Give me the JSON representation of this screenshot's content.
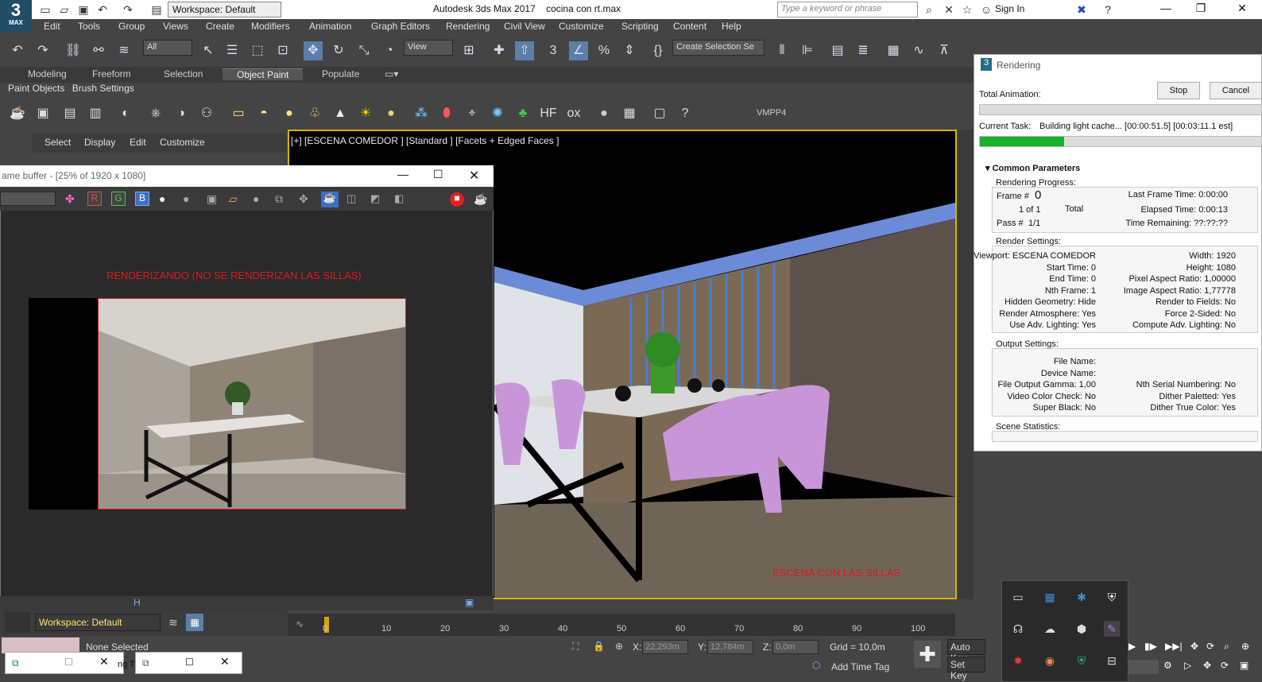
{
  "app": {
    "title": "Autodesk 3ds Max 2017",
    "file": "cocina con rt.max",
    "logo_num": "3",
    "logo_txt": "MAX"
  },
  "workspace": "Workspace: Default",
  "search_placeholder": "Type a keyword or phrase",
  "signin": "Sign In",
  "menu": [
    "Edit",
    "Tools",
    "Group",
    "Views",
    "Create",
    "Modifiers",
    "Animation",
    "Graph Editors",
    "Rendering",
    "Civil View",
    "Customize",
    "Scripting",
    "Content",
    "Help"
  ],
  "toolbar": {
    "filter": "All",
    "view": "View",
    "selection_set": "Create Selection Se"
  },
  "ribbon_tabs": [
    "Modeling",
    "Freeform",
    "Selection",
    "Object Paint",
    "Populate"
  ],
  "ribbon_active": "Object Paint",
  "subtabs": [
    "Paint Objects",
    "Brush Settings"
  ],
  "shelf_label": "VMPP4",
  "scene_menu": [
    "Select",
    "Display",
    "Edit",
    "Customize"
  ],
  "viewport": {
    "label": "[+] [ESCENA COMEDOR ] [Standard ] [Facets + Edged Faces ]",
    "note": "ESCENA CON LAS SILLAS"
  },
  "frame_buffer": {
    "title": "ame buffer - [25% of 1920 x 1080]",
    "note": "RENDERIZANDO (NO SE RENDERIZAN LAS SILLAS)",
    "rgb": [
      "R",
      "G",
      "B"
    ]
  },
  "render_dialog": {
    "title": "Rendering",
    "total_animation": "Total Animation:",
    "stop": "Stop",
    "cancel": "Cancel",
    "current_task_label": "Current Task:",
    "current_task": "Building light cache... [00:00:51.5] [00:03:11.1 est]",
    "progress": 0.3,
    "common_params": "Common Parameters",
    "rendering_progress": "Rendering Progress:",
    "frame_label": "Frame #",
    "frame": "0",
    "one_of": "1 of 1",
    "total": "Total",
    "pass_label": "Pass #",
    "pass": "1/1",
    "last_frame": "Last Frame Time: 0:00:00",
    "elapsed": "Elapsed Time: 0:00:13",
    "remaining": "Time Remaining: ??:??:??",
    "render_settings": "Render Settings:",
    "settings_left": [
      "Viewport: ESCENA COMEDOR",
      "Start Time: 0",
      "End Time: 0",
      "Nth Frame: 1",
      "Hidden Geometry: Hide",
      "Render Atmosphere: Yes",
      "Use Adv. Lighting: Yes"
    ],
    "settings_right": [
      "Width: 1920",
      "Height: 1080",
      "Pixel Aspect Ratio: 1,00000",
      "Image Aspect Ratio: 1,77778",
      "Render to Fields: No",
      "Force 2-Sided: No",
      "Compute Adv. Lighting: No"
    ],
    "output_settings": "Output Settings:",
    "output_left": [
      "File Name:",
      "Device Name:",
      "File Output Gamma: 1,00",
      "Video Color Check: No",
      "Super Black: No"
    ],
    "output_right": [
      "",
      "",
      "Nth Serial Numbering: No",
      "Dither Paletted: Yes",
      "Dither True Color: Yes"
    ],
    "scene_stats": "Scene Statistics:"
  },
  "timeline": {
    "ticks": [
      "0",
      "10",
      "20",
      "30",
      "40",
      "50",
      "60",
      "70",
      "80",
      "90",
      "100"
    ]
  },
  "status": {
    "none_selected": "None Selected",
    "x": "22,293m",
    "y": "12,784m",
    "z": "0,0m",
    "grid": "Grid = 10,0m",
    "auto_key": "Auto Key",
    "set_key": "Set Key",
    "add_time_tag": "Add Time Tag",
    "workspace_bottom": "Workspace: Default",
    "x_label": "X:",
    "y_label": "Y:",
    "z_label": "Z:",
    "ng": "ng T"
  }
}
